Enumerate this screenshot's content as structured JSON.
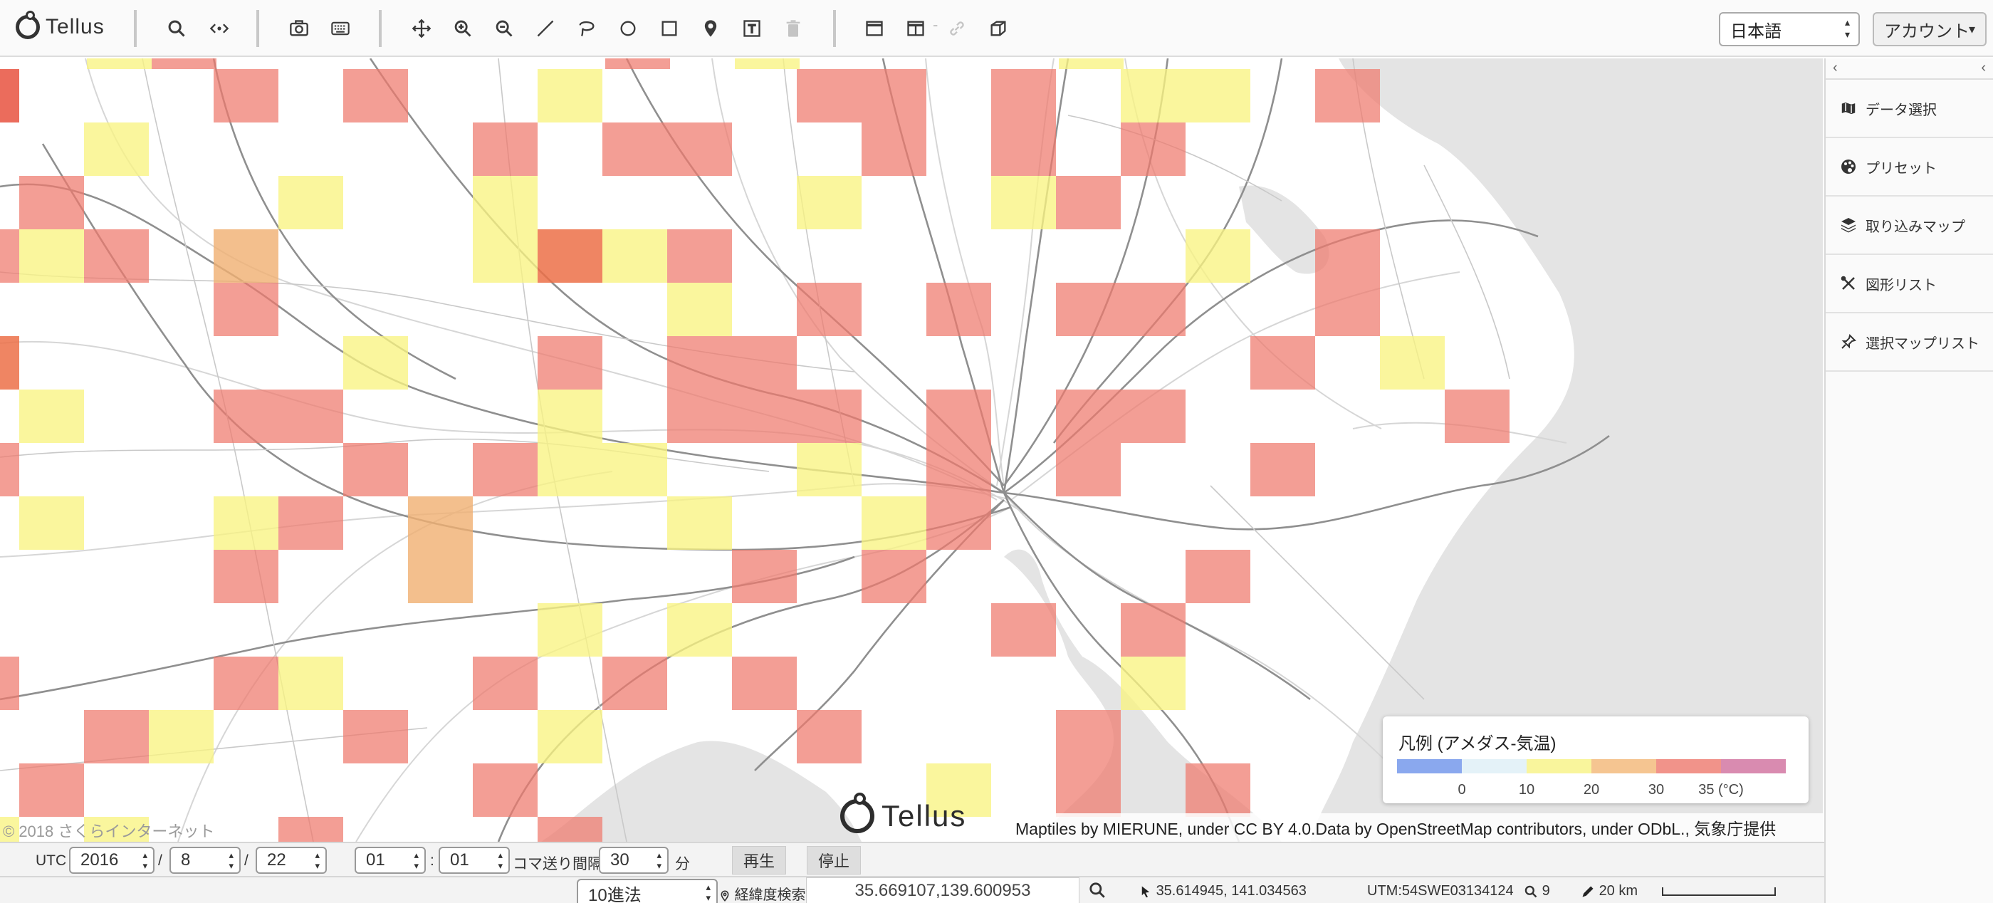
{
  "app": {
    "name": "Tellus"
  },
  "toolbar": {
    "language": "日本語",
    "account_label": "アカウント",
    "link_separator": "-"
  },
  "map": {
    "copyright": "© 2018 さくらインターネット",
    "logo_text": "Tellus",
    "attribution": "Maptiles by MIERUNE, under CC BY 4.0.Data by OpenStreetMap contributors, under ODbL., 気象庁提供",
    "legend": {
      "title": "凡例 (アメダス-気温)",
      "colors": [
        "#8aa8ee",
        "#e4f2f8",
        "#f9f59c",
        "#f5c591",
        "#f1938a",
        "#d98bb0"
      ],
      "ticks": [
        "0",
        "10",
        "20",
        "30",
        "35 (°C)"
      ]
    }
  },
  "sidebar": {
    "collapse_left": "‹",
    "collapse_right": "‹",
    "items": [
      {
        "label": "データ選択",
        "icon": "map-icon"
      },
      {
        "label": "プリセット",
        "icon": "palette-icon"
      },
      {
        "label": "取り込みマップ",
        "icon": "layers-icon"
      },
      {
        "label": "図形リスト",
        "icon": "tools-icon"
      },
      {
        "label": "選択マップリスト",
        "icon": "pin-list-icon"
      }
    ]
  },
  "timebar": {
    "utc_label": "UTC",
    "year": "2016",
    "month": "8",
    "day": "22",
    "slash": "/",
    "hour": "01",
    "colon": ":",
    "minute": "01",
    "interval_label": "コマ送り間隔",
    "interval": "30",
    "interval_unit": "分",
    "play_label": "再生",
    "stop_label": "停止"
  },
  "statusbar": {
    "number_system": "10進法",
    "latlon_search_label": "経緯度検索",
    "latlon_value": "35.669107,139.600953",
    "cursor_coords": "35.614945, 141.034563",
    "utm": "UTM:54SWE03134124",
    "zoom": "9",
    "scale": "20 km"
  }
}
